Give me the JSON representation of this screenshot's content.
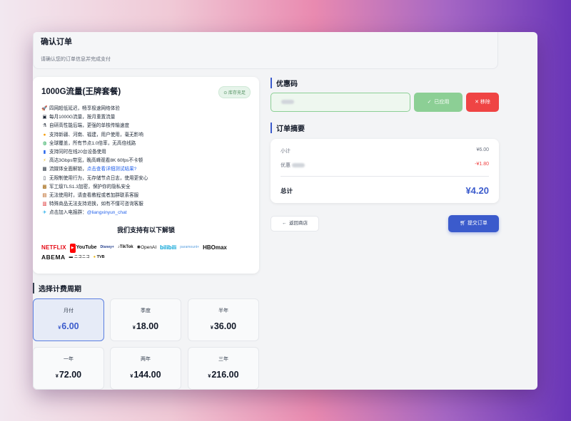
{
  "header": {
    "title": "确认订单",
    "subtitle": "请确认您的订单信息并完成支付"
  },
  "plan": {
    "title": "1000G流量(王牌套餐)",
    "stock_badge": "库存充足",
    "features": [
      {
        "icon": "🚀",
        "text": "四网超低延迟，畅享极速网络体验"
      },
      {
        "icon": "▣",
        "text": "每月1000G流量，按月重置流量"
      },
      {
        "icon": "⚗",
        "text": "自研高性能后端，更强的单核传输速度"
      },
      {
        "icon": "●",
        "text": "支持新疆、河南、福建，用户使用，毫无影响"
      },
      {
        "icon": "◍",
        "text": "全球覆盖，所有节点1.0倍率，无高倍线路"
      },
      {
        "icon": "▮",
        "text": "支持同时在线20台设备使用"
      },
      {
        "icon": "⚡",
        "text": "高达3Gbps带宽，晚高峰观看8K 60fps不卡顿"
      },
      {
        "icon": "▦",
        "text": "流媒体全面解锁，",
        "link": "点击查看详细测试结果?"
      },
      {
        "icon": "▯",
        "text": "无限制使用行为，无存储节点日志，使用更安心"
      },
      {
        "icon": "▩",
        "text": "军工级TLS1.3加密，保护你的隐私安全"
      },
      {
        "icon": "▤",
        "text": "无法使用时，请查看教程或者加群联系客服"
      },
      {
        "icon": "▥",
        "text": "特殊商品无法支持退换，如有不懂可咨询客服"
      },
      {
        "icon": "✈",
        "text": "点击加入电报群：",
        "link": "@liangxinyun_chat"
      }
    ],
    "unlock_title": "我们支持有以下解锁",
    "logos": [
      "NETFLIX",
      "YouTube",
      "Disney+",
      "TikTok",
      "OpenAI",
      "bilibili",
      "paramount+",
      "HBOmax",
      "ABEMA",
      "ニコニコ",
      "TVB"
    ]
  },
  "billing": {
    "heading": "选择计费周期",
    "currency": "¥",
    "options": [
      {
        "name": "月付",
        "price": "6.00",
        "selected": true
      },
      {
        "name": "季度",
        "price": "18.00",
        "selected": false
      },
      {
        "name": "半年",
        "price": "36.00",
        "selected": false
      },
      {
        "name": "一年",
        "price": "72.00",
        "selected": false
      },
      {
        "name": "两年",
        "price": "144.00",
        "selected": false
      },
      {
        "name": "三年",
        "price": "216.00",
        "selected": false
      }
    ]
  },
  "coupon": {
    "heading": "优惠码",
    "applied_label": "已应用",
    "remove_label": "移除"
  },
  "summary": {
    "heading": "订单摘要",
    "subtotal_label": "小计",
    "subtotal_value": "¥6.00",
    "discount_label": "优惠",
    "discount_value": "-¥1.80",
    "total_label": "总计",
    "total_value": "¥4.20"
  },
  "actions": {
    "back_label": "返回商店",
    "submit_label": "提交订单"
  },
  "colors": {
    "primary": "#3b5bcc",
    "success": "#8ccf95",
    "danger": "#ef4444"
  }
}
